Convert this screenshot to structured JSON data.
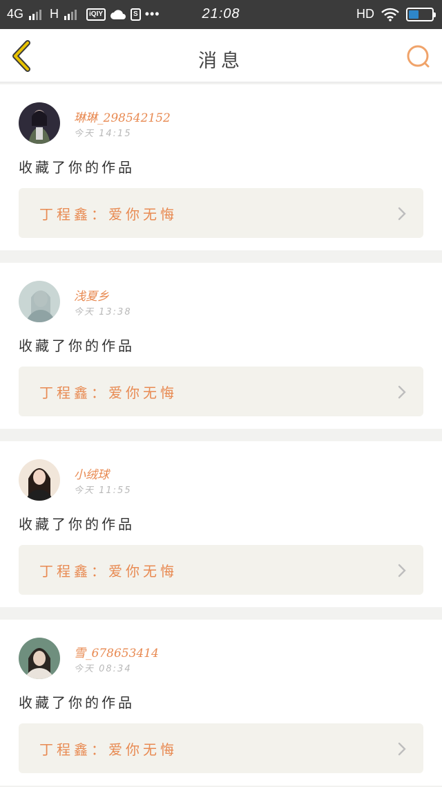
{
  "status_bar": {
    "network": "4G",
    "network2": "H",
    "app_badge": "iQIY",
    "s_badge": "S",
    "dots": "•••",
    "time": "21:08",
    "hd": "HD"
  },
  "header": {
    "title": "消息"
  },
  "notifications": [
    {
      "username": "琳琳_298542152",
      "time": "今天 14:15",
      "action": "收藏了你的作品",
      "work": "丁程鑫：爱你无悔"
    },
    {
      "username": "浅夏乡",
      "time": "今天 13:38",
      "action": "收藏了你的作品",
      "work": "丁程鑫：爱你无悔"
    },
    {
      "username": "小绒球",
      "time": "今天 11:55",
      "action": "收藏了你的作品",
      "work": "丁程鑫：爱你无悔"
    },
    {
      "username": "雪_678653414",
      "time": "今天 08:34",
      "action": "收藏了你的作品",
      "work": "丁程鑫：爱你无悔"
    }
  ],
  "colors": {
    "accent": "#e88a52",
    "back_icon": "#c9a200",
    "search_icon": "#f0a36a",
    "card_link_bg": "#f3f2ec",
    "page_bg": "#f2f2f0",
    "status_bar": "#3b3b3b"
  }
}
